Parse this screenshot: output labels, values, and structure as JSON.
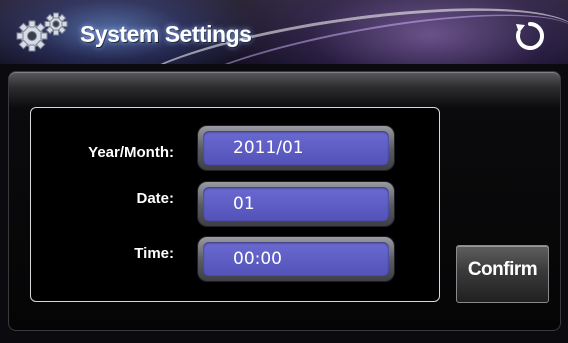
{
  "header": {
    "title": "System Settings",
    "icon": "gears-icon",
    "refresh_icon": "refresh-icon"
  },
  "form": {
    "year_month": {
      "label": "Year/Month:",
      "value": "2011/01"
    },
    "date": {
      "label": "Date:",
      "value": "01"
    },
    "time": {
      "label": "Time:",
      "value": "00:00"
    }
  },
  "confirm_button": {
    "label": "Confirm"
  },
  "colors": {
    "field_fill": "#5a5ac4",
    "background": "#0a0a0f",
    "text": "#ffffff"
  }
}
